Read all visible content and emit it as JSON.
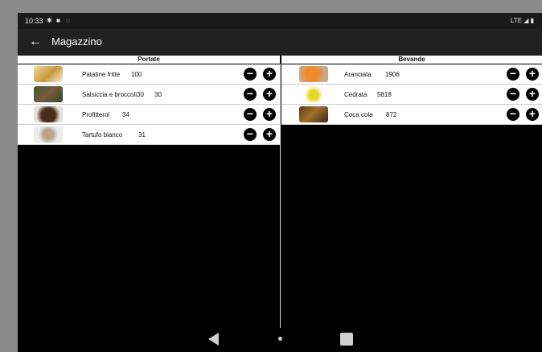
{
  "status_bar": {
    "time": "10:33",
    "right_indicators": "LTE"
  },
  "app_bar": {
    "title": "Magazzino",
    "back_icon": "arrow-left-icon"
  },
  "columns": {
    "left": {
      "header": "Portate",
      "items": [
        {
          "name": "Patatine fritte",
          "qty": "100",
          "image": "fries-photo"
        },
        {
          "name": "Salsiccia e broccoli30",
          "qty": "30",
          "image": "sausage-photo"
        },
        {
          "name": "Profitterol",
          "qty": "34",
          "image": "profiterole-photo"
        },
        {
          "name": "Tartufo bianco",
          "qty": "31",
          "image": "truffle-photo"
        }
      ]
    },
    "right": {
      "header": "Bevande",
      "items": [
        {
          "name": "Aranciata",
          "qty": "1906",
          "image": "orange-soda-photo"
        },
        {
          "name": "Cedrata",
          "qty": "5818",
          "image": "cedrata-photo"
        },
        {
          "name": "Coca cola",
          "qty": "872",
          "image": "cola-photo"
        }
      ]
    }
  },
  "buttons": {
    "minus": "−",
    "plus": "+"
  },
  "colors": {
    "app_bar": "#212121",
    "row_background": "#ffffff",
    "screen_background": "#000000"
  }
}
